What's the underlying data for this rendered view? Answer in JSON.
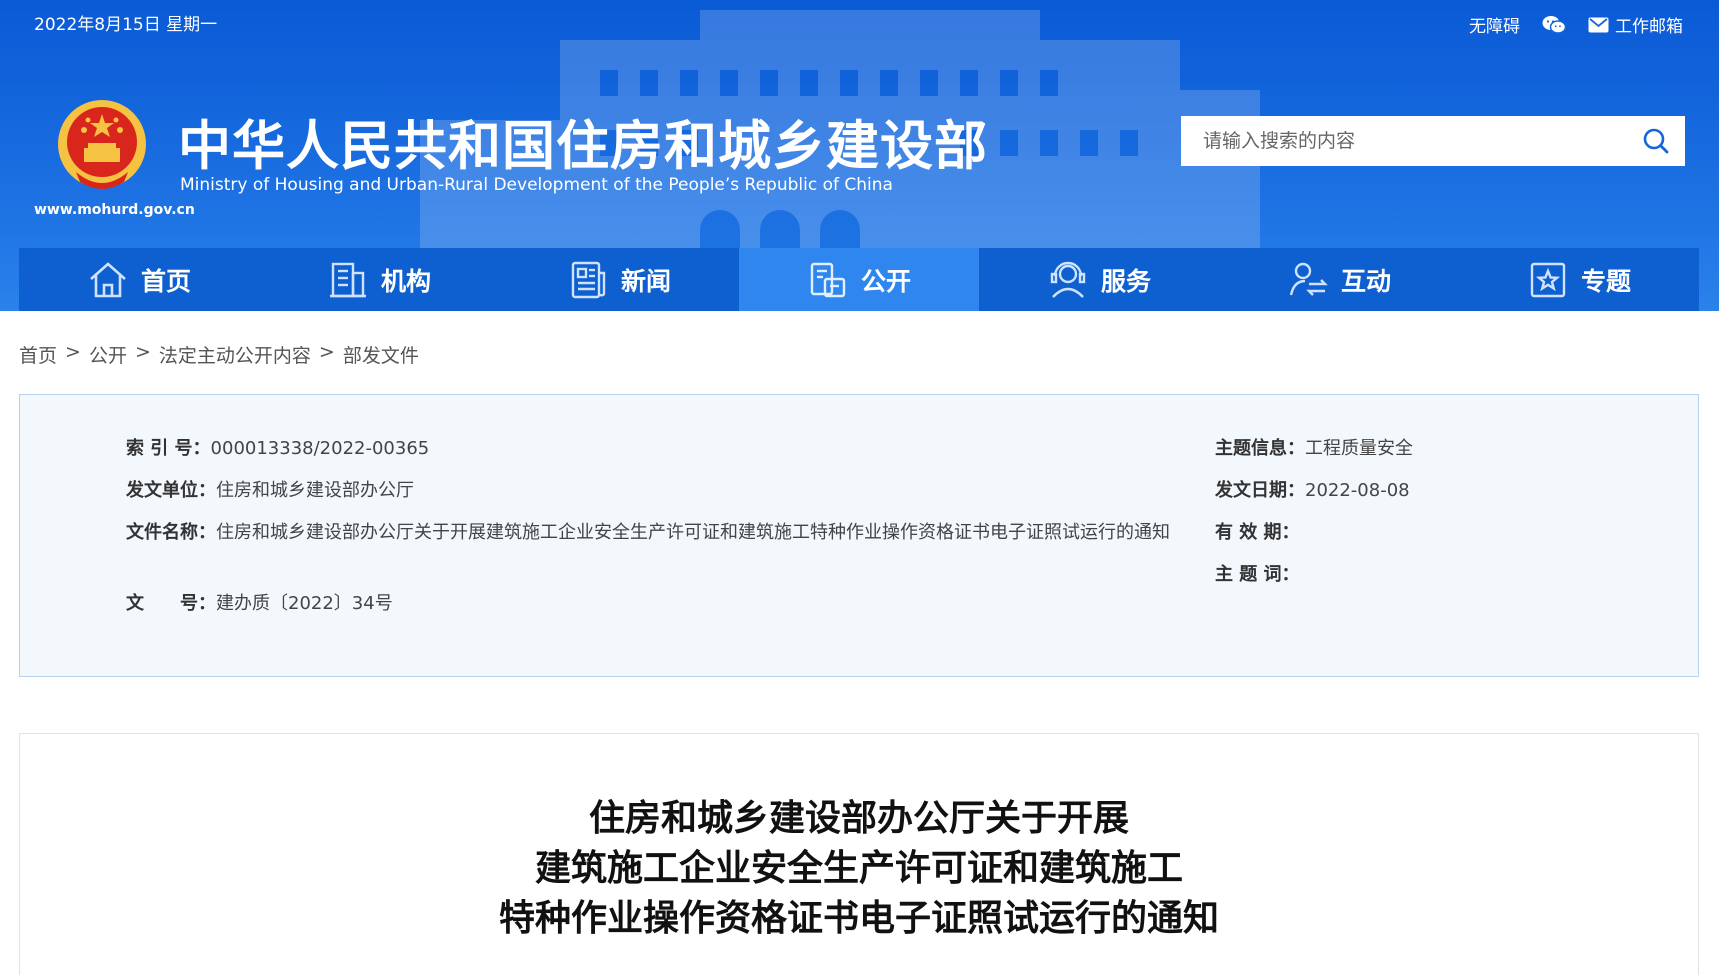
{
  "topbar": {
    "date": "2022年8月15日 星期一",
    "accessibility": "无障碍",
    "wechat_icon": "wechat-icon",
    "mail_label": "工作邮箱",
    "mail_icon": "mail-icon"
  },
  "site": {
    "title_cn": "中华人民共和国住房和城乡建设部",
    "title_en": "Ministry of Housing and Urban-Rural Development of the People’s Republic of China",
    "url": "www.mohurd.gov.cn"
  },
  "search": {
    "placeholder": "请输入搜索的内容",
    "icon": "search-icon"
  },
  "nav": {
    "items": [
      {
        "label": "首页",
        "icon": "home-icon"
      },
      {
        "label": "机构",
        "icon": "building-icon"
      },
      {
        "label": "新闻",
        "icon": "news-icon"
      },
      {
        "label": "公开",
        "icon": "disclosure-icon",
        "active": true
      },
      {
        "label": "服务",
        "icon": "service-icon"
      },
      {
        "label": "互动",
        "icon": "interaction-icon"
      },
      {
        "label": "专题",
        "icon": "topic-star-icon"
      }
    ]
  },
  "breadcrumb": {
    "items": [
      "首页",
      "公开",
      "法定主动公开内容",
      "部发文件"
    ],
    "separator": ">"
  },
  "info": {
    "index_label": "索 引 号：",
    "index_value": "000013338/2022-00365",
    "issuer_label": "发文单位：",
    "issuer_value": "住房和城乡建设部办公厅",
    "filename_label": "文件名称：",
    "filename_value": "住房和城乡建设部办公厅关于开展建筑施工企业安全生产许可证和建筑施工特种作业操作资格证书电子证照试运行的通知",
    "docno_label": "文　　号：",
    "docno_value": "建办质〔2022〕34号",
    "topic_label": "主题信息：",
    "topic_value": "工程质量安全",
    "date_label": "发文日期：",
    "date_value": "2022-08-08",
    "validity_label": "有 效 期：",
    "validity_value": "",
    "keywords_label": "主 题 词：",
    "keywords_value": ""
  },
  "article": {
    "title_line1": "住房和城乡建设部办公厅关于开展",
    "title_line2": "建筑施工企业安全生产许可证和建筑施工",
    "title_line3": "特种作业操作资格证书电子证照试运行的通知"
  },
  "colors": {
    "header_blue": "#1466dc",
    "nav_blue": "#0e5fd0",
    "nav_active": "#2f86ee",
    "info_bg": "#f3f8fd"
  }
}
